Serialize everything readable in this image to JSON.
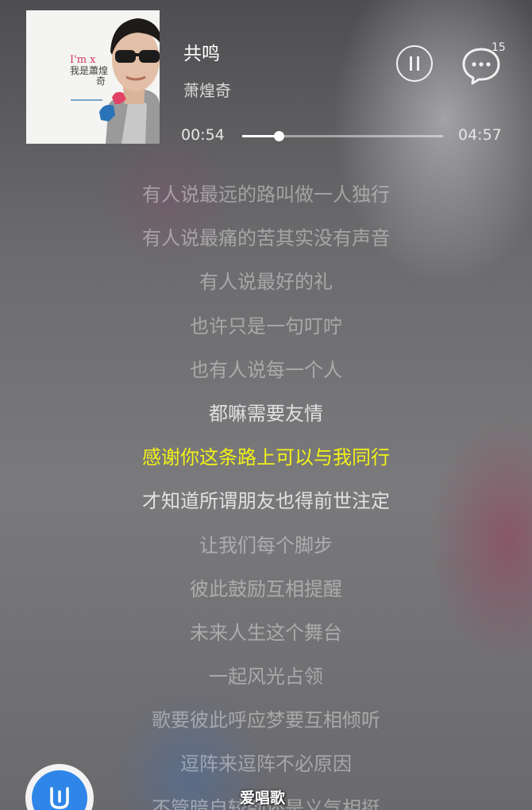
{
  "player": {
    "album_art": {
      "icon": "album-cover-icon",
      "cover_text_line1": "I'm x",
      "cover_text_line2": "我是蕭煌",
      "cover_text_line3": "奇"
    },
    "song_title": "共鸣",
    "artist": "萧煌奇",
    "pause_icon": "pause-icon",
    "comment_icon": "comment-bubble-icon",
    "comment_count": "15",
    "current_time": "00:54",
    "total_time": "04:57",
    "progress": 0.182
  },
  "lyrics": {
    "current_index": 6,
    "lines": [
      "有人说最远的路叫做一人独行",
      "有人说最痛的苦其实没有声音",
      "有人说最好的礼",
      "也许只是一句叮咛",
      "也有人说每一个人",
      "都嘛需要友情",
      "感谢你这条路上可以与我同行",
      "才知道所谓朋友也得前世注定",
      "让我们每个脚步",
      "彼此鼓励互相提醒",
      "未来人生这个舞台",
      "一起风光占领",
      "歌要彼此呼应梦要互相倾听",
      "逗阵来逗阵不必原因",
      "不管暗自较劲还是义气相挺"
    ]
  },
  "floating_button": {
    "icon": "voice-assistant-icon"
  },
  "watermark": "爱唱歌",
  "colors": {
    "highlight": "#f1f119",
    "fab_blue": "#2f86e8"
  }
}
